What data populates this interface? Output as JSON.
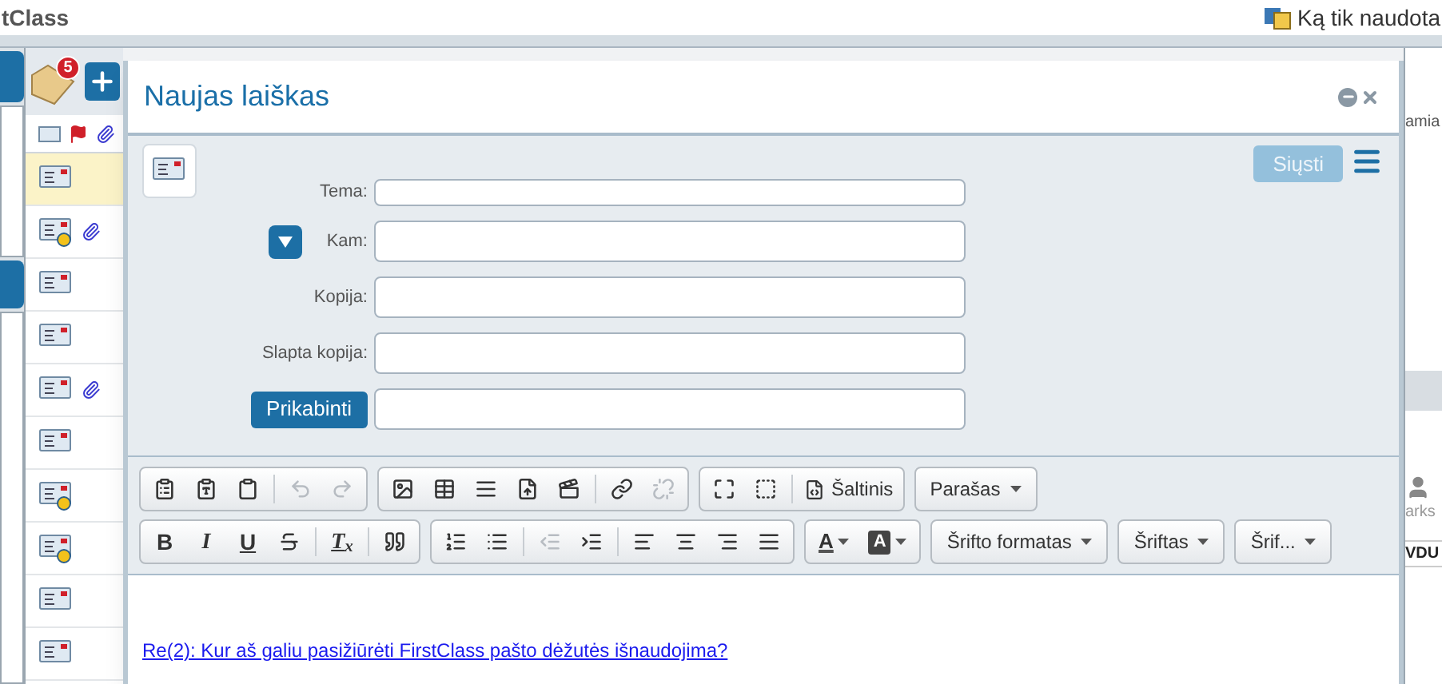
{
  "app": {
    "title_fragment": "tClass",
    "recent": "Ką tik naudota",
    "badge_count": "5",
    "right_texts": [
      "amia",
      "arks",
      "VDU"
    ]
  },
  "message_list": {
    "rows": [
      {
        "selected": true,
        "badge": false,
        "attachment": false
      },
      {
        "selected": false,
        "badge": true,
        "attachment": true
      },
      {
        "selected": false,
        "badge": false,
        "attachment": false
      },
      {
        "selected": false,
        "badge": false,
        "attachment": false
      },
      {
        "selected": false,
        "badge": false,
        "attachment": true
      },
      {
        "selected": false,
        "badge": false,
        "attachment": false
      },
      {
        "selected": false,
        "badge": true,
        "attachment": false
      },
      {
        "selected": false,
        "badge": true,
        "attachment": false
      },
      {
        "selected": false,
        "badge": false,
        "attachment": false
      },
      {
        "selected": false,
        "badge": false,
        "attachment": false
      }
    ]
  },
  "dialog": {
    "title": "Naujas laiškas",
    "send": {
      "label": "Siųsti",
      "disabled": true
    },
    "fields": [
      {
        "kind": "compact",
        "label": "Tema:"
      },
      {
        "kind": "toggle",
        "label": "Kam:"
      },
      {
        "kind": "plain",
        "label": "Kopija:"
      },
      {
        "kind": "plain",
        "label": "Slapta kopija:"
      },
      {
        "kind": "attach",
        "label": "Prikabinti"
      }
    ],
    "toolbar": {
      "rows": [
        [
          [
            {
              "kind": "icon",
              "disabled": false
            },
            {
              "kind": "icon",
              "disabled": false
            },
            {
              "kind": "icon",
              "disabled": false
            },
            {
              "kind": "separator"
            },
            {
              "kind": "icon",
              "disabled": true
            },
            {
              "kind": "icon",
              "disabled": true
            }
          ],
          [
            {
              "kind": "icon",
              "disabled": false
            },
            {
              "kind": "icon",
              "disabled": false
            },
            {
              "kind": "icon",
              "disabled": false
            },
            {
              "kind": "icon",
              "disabled": false
            },
            {
              "kind": "icon",
              "disabled": false
            },
            {
              "kind": "separator"
            },
            {
              "kind": "icon",
              "disabled": false
            },
            {
              "kind": "icon",
              "disabled": true
            }
          ],
          [
            {
              "kind": "icon",
              "disabled": false
            },
            {
              "kind": "icon",
              "disabled": false
            },
            {
              "kind": "separator"
            },
            {
              "kind": "source",
              "label": "Šaltinis"
            }
          ],
          [
            {
              "kind": "dropdown",
              "label": "Parašas"
            }
          ]
        ],
        [
          [
            {
              "kind": "bold",
              "label": "B"
            },
            {
              "kind": "italic",
              "label": "I"
            },
            {
              "kind": "underline",
              "label": "U"
            },
            {
              "kind": "icon",
              "disabled": false
            },
            {
              "kind": "separator"
            },
            {
              "kind": "clear",
              "label": "T$_{x}$"
            },
            {
              "kind": "separator"
            },
            {
              "kind": "icon",
              "disabled": false
            }
          ],
          [
            {
              "kind": "icon",
              "disabled": false
            },
            {
              "kind": "icon",
              "disabled": false
            },
            {
              "kind": "separator"
            },
            {
              "kind": "icon",
              "disabled": true
            },
            {
              "kind": "icon",
              "disabled": false
            },
            {
              "kind": "separator"
            },
            {
              "kind": "icon",
              "disabled": false
            },
            {
              "kind": "icon",
              "disabled": false
            },
            {
              "kind": "icon",
              "disabled": false
            },
            {
              "kind": "icon",
              "disabled": false
            }
          ],
          [
            {
              "kind": "color",
              "label": "A"
            },
            {
              "kind": "bgcolor",
              "label": "A"
            }
          ],
          [
            {
              "kind": "dropdown",
              "label": "Šrifto formatas"
            }
          ],
          [
            {
              "kind": "dropdown",
              "label": "Šriftas"
            }
          ],
          [
            {
              "kind": "dropdown",
              "label": "Šrif..."
            }
          ]
        ]
      ]
    },
    "body_link": "Re(2): Kur aš galiu pasižiūrėti FirstClass pašto dėžutės išnaudojima?"
  }
}
